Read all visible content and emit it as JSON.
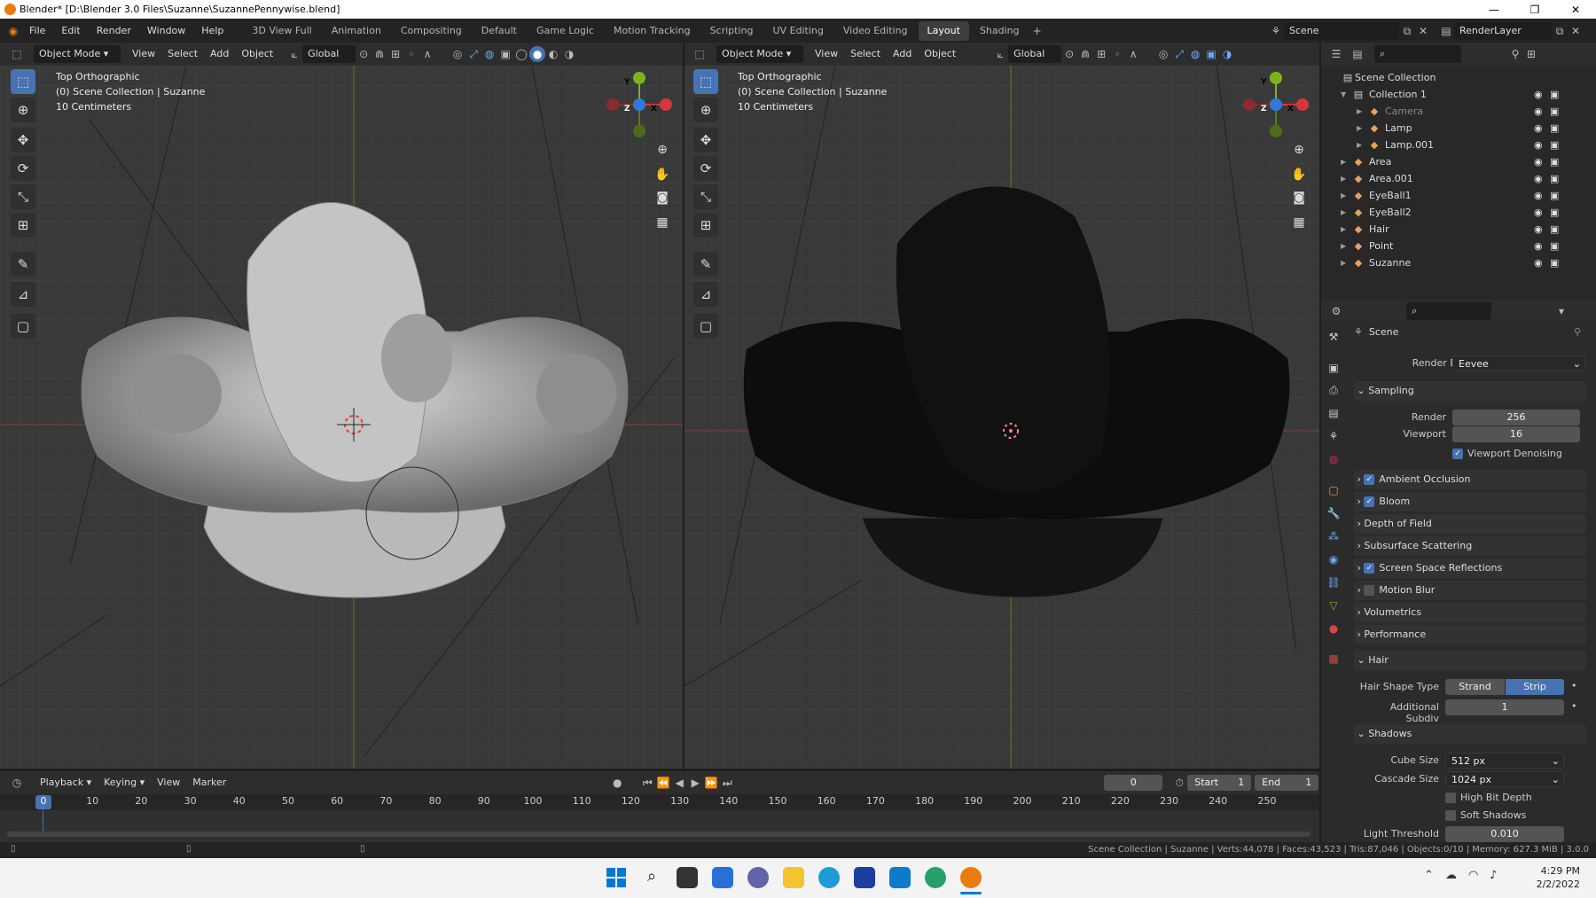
{
  "window": {
    "title": "Blender* [D:\\Blender 3.0 Files\\Suzanne\\SuzannePennywise.blend]"
  },
  "menu": [
    "File",
    "Edit",
    "Render",
    "Window",
    "Help"
  ],
  "workspaces": [
    "3D View Full",
    "Animation",
    "Compositing",
    "Default",
    "Game Logic",
    "Motion Tracking",
    "Scripting",
    "UV Editing",
    "Video Editing",
    "Layout",
    "Shading"
  ],
  "active_workspace": "Layout",
  "scene": {
    "name": "Scene",
    "view_layer": "RenderLayer"
  },
  "viewport_header": {
    "mode": "Object Mode",
    "menus": [
      "View",
      "Select",
      "Add",
      "Object"
    ],
    "orientation": "Global"
  },
  "viewport_left": {
    "view": "Top Orthographic",
    "collection": "(0) Scene Collection | Suzanne",
    "scale": "10 Centimeters"
  },
  "viewport_right": {
    "view": "Top Orthographic",
    "collection": "(0) Scene Collection | Suzanne",
    "scale": "10 Centimeters"
  },
  "gizmo": {
    "x": "X",
    "y": "Y",
    "z": "Z"
  },
  "outliner": {
    "root": "Scene Collection",
    "items": [
      {
        "name": "Collection 1",
        "level": 0
      },
      {
        "name": "Camera",
        "level": 1
      },
      {
        "name": "Lamp",
        "level": 1
      },
      {
        "name": "Lamp.001",
        "level": 1
      },
      {
        "name": "Area",
        "level": 0
      },
      {
        "name": "Area.001",
        "level": 0
      },
      {
        "name": "EyeBall1",
        "level": 0
      },
      {
        "name": "EyeBall2",
        "level": 0
      },
      {
        "name": "Hair",
        "level": 0
      },
      {
        "name": "Point",
        "level": 0
      },
      {
        "name": "Suzanne",
        "level": 0
      }
    ]
  },
  "properties": {
    "context": "Scene",
    "render_engine_label": "Render Engine",
    "render_engine": "Eevee",
    "sampling": {
      "title": "Sampling",
      "render_label": "Render",
      "render": "256",
      "viewport_label": "Viewport",
      "viewport": "16",
      "denoise": "Viewport Denoising"
    },
    "panels": [
      {
        "label": "Ambient Occlusion",
        "checkbox": true,
        "checked": true
      },
      {
        "label": "Bloom",
        "checkbox": true,
        "checked": true
      },
      {
        "label": "Depth of Field",
        "checkbox": false
      },
      {
        "label": "Subsurface Scattering",
        "checkbox": false
      },
      {
        "label": "Screen Space Reflections",
        "checkbox": true,
        "checked": true
      },
      {
        "label": "Motion Blur",
        "checkbox": true,
        "checked": false
      },
      {
        "label": "Volumetrics",
        "checkbox": false
      },
      {
        "label": "Performance",
        "checkbox": false
      }
    ],
    "hair": {
      "title": "Hair",
      "shape_label": "Hair Shape Type",
      "strand": "Strand",
      "strip": "Strip",
      "subdiv_label": "Additional Subdiv",
      "subdiv": "1"
    },
    "shadows": {
      "title": "Shadows",
      "cube_label": "Cube Size",
      "cube": "512 px",
      "cascade_label": "Cascade Size",
      "cascade": "1024 px",
      "high_bit": "High Bit Depth",
      "soft": "Soft Shadows",
      "threshold_label": "Light Threshold",
      "threshold": "0.010"
    }
  },
  "timeline": {
    "menus": [
      "Playback",
      "Keying",
      "View",
      "Marker"
    ],
    "current": "0",
    "start_label": "Start",
    "start": "1",
    "end_label": "End",
    "end": "1",
    "ticks": [
      "0",
      "10",
      "20",
      "30",
      "40",
      "50",
      "60",
      "70",
      "80",
      "90",
      "100",
      "110",
      "120",
      "130",
      "140",
      "150",
      "160",
      "170",
      "180",
      "190",
      "200",
      "210",
      "220",
      "230",
      "240",
      "250"
    ]
  },
  "statusbar": "Scene Collection | Suzanne | Verts:44,078 | Faces:43,523 | Tris:87,046 | Objects:0/10 | Memory: 627.3 MiB | 3.0.0",
  "clock": {
    "time": "4:29 PM",
    "date": "2/2/2022"
  },
  "colors": {
    "accent": "#4772b3",
    "x_axis": "#d4373d",
    "y_axis": "#7fb21a",
    "z_axis": "#2f7ad6"
  }
}
